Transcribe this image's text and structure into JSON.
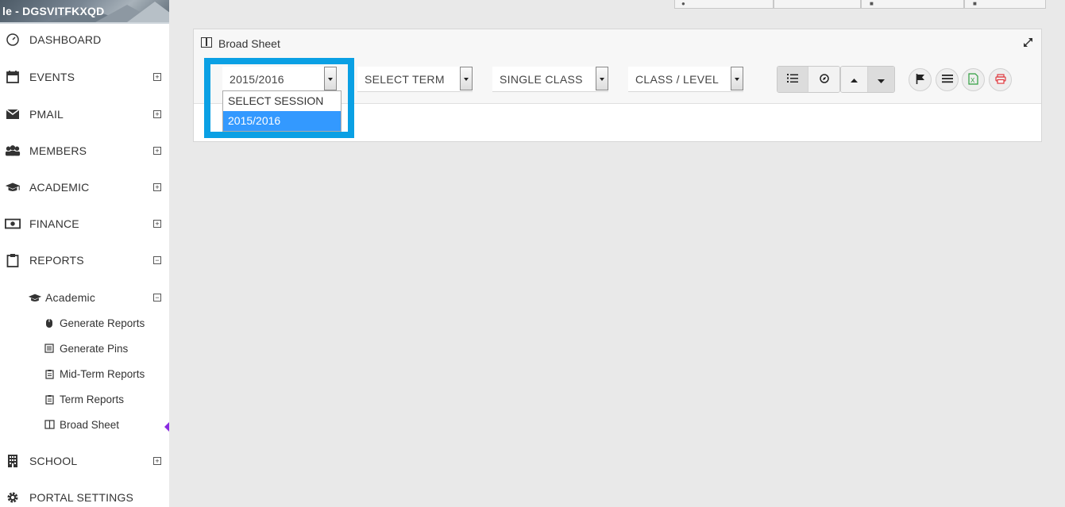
{
  "brand": {
    "text": "le - DGSVITFKXQD"
  },
  "sidebar": {
    "items": [
      {
        "label": "DASHBOARD",
        "icon": "dashboard-icon",
        "toggle": ""
      },
      {
        "label": "EVENTS",
        "icon": "calendar-icon",
        "toggle": "+"
      },
      {
        "label": "PMAIL",
        "icon": "envelope-icon",
        "toggle": "+"
      },
      {
        "label": "MEMBERS",
        "icon": "users-icon",
        "toggle": "+"
      },
      {
        "label": "ACADEMIC",
        "icon": "graduation-cap-icon",
        "toggle": "+"
      },
      {
        "label": "FINANCE",
        "icon": "money-icon",
        "toggle": "+"
      },
      {
        "label": "REPORTS",
        "icon": "clipboard-icon",
        "toggle": "−"
      },
      {
        "label": "SCHOOL",
        "icon": "building-icon",
        "toggle": "+"
      },
      {
        "label": "PORTAL SETTINGS",
        "icon": "gear-icon",
        "toggle": ""
      }
    ],
    "reports_sub": {
      "academic": {
        "label": "Academic",
        "icon": "graduation-cap-icon",
        "toggle": "−"
      },
      "items": [
        {
          "label": "Generate Reports",
          "icon": "mouse-icon"
        },
        {
          "label": "Generate Pins",
          "icon": "list-icon"
        },
        {
          "label": "Mid-Term Reports",
          "icon": "clipboard-list-icon"
        },
        {
          "label": "Term Reports",
          "icon": "clipboard-list-icon"
        },
        {
          "label": "Broad Sheet",
          "icon": "columns-icon"
        }
      ]
    }
  },
  "panel": {
    "title": "Broad Sheet",
    "session_select": {
      "value": "2015/2016",
      "options": [
        "SELECT SESSION",
        "2015/2016"
      ],
      "selected_index": 1
    },
    "term_select": {
      "value": "SELECT TERM"
    },
    "class_type_select": {
      "value": "SINGLE CLASS"
    },
    "class_level_select": {
      "value": "CLASS / LEVEL"
    }
  },
  "colors": {
    "highlight": "#0aa0e4",
    "selected_option": "#3399ff",
    "active_marker": "#8a2be2"
  }
}
